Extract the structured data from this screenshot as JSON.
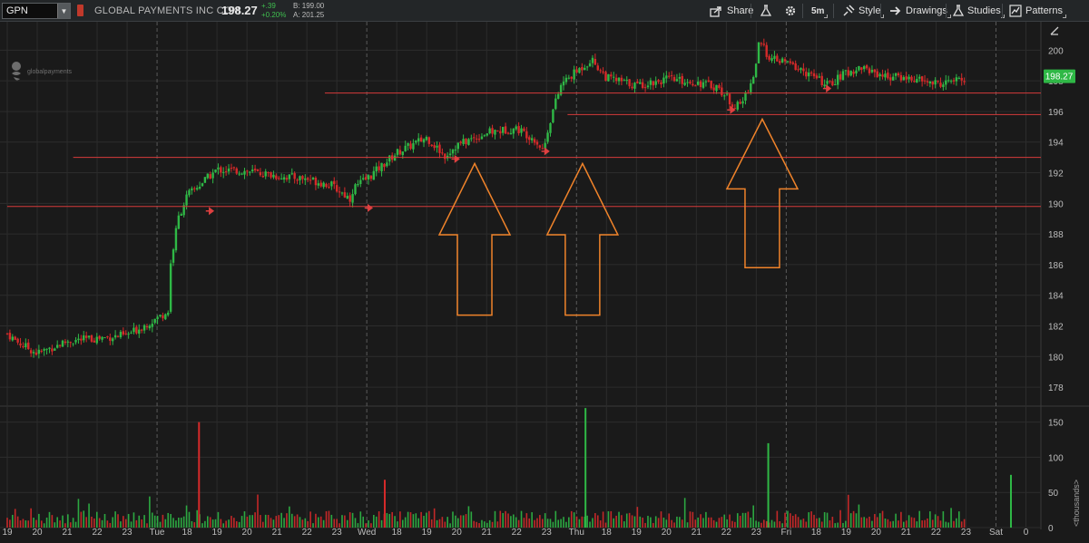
{
  "header": {
    "symbol": "GPN",
    "company_name": "GLOBAL PAYMENTS INC COM",
    "last_price": "198.27",
    "change": "+.39",
    "change_pct": "+0.20%",
    "bid": "B: 199.00",
    "ask": "A: 201.25"
  },
  "toolbar": {
    "share": "Share",
    "timeframe": "5m",
    "style": "Style",
    "drawings": "Drawings",
    "studies": "Studies",
    "patterns": "Patterns"
  },
  "logo": {
    "text": "globalpayments"
  },
  "colors": {
    "up": "#2fb846",
    "down": "#d62a2a",
    "level_line": "#d63a3a",
    "arrow_outline": "#f0832a",
    "price_badge": "#2fb846",
    "grid": "#2c2c2c",
    "session_divider": "#5a5a5a"
  },
  "chart_data": {
    "type": "candlestick",
    "symbol": "GPN",
    "interval": "5m",
    "price_axis": {
      "ticks": [
        178,
        180,
        182,
        184,
        186,
        188,
        190,
        192,
        194,
        196,
        198,
        200
      ],
      "range": [
        177,
        201.5
      ],
      "last_price_label": "198.27"
    },
    "volume_axis": {
      "label": "<thousands>",
      "ticks": [
        0,
        50,
        100,
        150
      ],
      "range": [
        0,
        165
      ]
    },
    "time_axis": {
      "labels": [
        "19",
        "20",
        "21",
        "22",
        "23",
        "Tue",
        "18",
        "19",
        "20",
        "21",
        "22",
        "23",
        "Wed",
        "18",
        "19",
        "20",
        "21",
        "22",
        "23",
        "Thu",
        "18",
        "19",
        "20",
        "21",
        "22",
        "23",
        "Fri",
        "18",
        "19",
        "20",
        "21",
        "22",
        "23",
        "Sat",
        "0"
      ]
    },
    "price_path": [
      [
        0,
        181.5
      ],
      [
        0.3,
        181
      ],
      [
        1,
        180.2
      ],
      [
        2,
        181
      ],
      [
        3,
        181.2
      ],
      [
        4,
        181.4
      ],
      [
        5,
        182.5
      ],
      [
        5.4,
        183
      ],
      [
        5.45,
        186
      ],
      [
        5.7,
        189
      ],
      [
        6,
        190.5
      ],
      [
        7,
        192.2
      ],
      [
        8,
        192.1
      ],
      [
        9,
        191.8
      ],
      [
        10,
        191.6
      ],
      [
        10.8,
        191.2
      ],
      [
        11.45,
        190.3
      ],
      [
        11.55,
        191
      ],
      [
        12,
        191.6
      ],
      [
        13,
        193.3
      ],
      [
        14,
        194.3
      ],
      [
        14.6,
        193.1
      ],
      [
        15,
        193.8
      ],
      [
        16,
        194.6
      ],
      [
        17,
        194.9
      ],
      [
        17.6,
        194.2
      ],
      [
        17.9,
        193.4
      ],
      [
        18,
        194.5
      ],
      [
        18.2,
        196
      ],
      [
        18.5,
        197.8
      ],
      [
        19,
        198.6
      ],
      [
        19.5,
        199.4
      ],
      [
        20,
        198.2
      ],
      [
        21,
        197.7
      ],
      [
        22,
        198.1
      ],
      [
        23,
        197.9
      ],
      [
        23.7,
        197.6
      ],
      [
        24.3,
        196.3
      ],
      [
        24.5,
        196.5
      ],
      [
        24.9,
        198.2
      ],
      [
        25.1,
        200.5
      ],
      [
        25.5,
        199.4
      ],
      [
        26,
        199.2
      ],
      [
        26.6,
        198.6
      ],
      [
        27.4,
        197.7
      ],
      [
        27.9,
        198.4
      ],
      [
        28.5,
        198.9
      ],
      [
        29.3,
        198.3
      ],
      [
        30,
        198.2
      ],
      [
        31,
        197.8
      ],
      [
        32,
        198.1
      ]
    ],
    "horizontal_levels": [
      {
        "price": 197.2,
        "x_start_session": 10.6
      },
      {
        "price": 195.8,
        "x_start_session": 18.7
      },
      {
        "price": 193.0,
        "x_start_session": 2.2
      },
      {
        "price": 189.8,
        "x_start_session": 0
      }
    ],
    "small_arrows": [
      {
        "session": 12.2,
        "price": 189.7
      },
      {
        "session": 6.9,
        "price": 189.5
      },
      {
        "session": 15.1,
        "price": 192.9
      },
      {
        "session": 18.1,
        "price": 193.4
      },
      {
        "session": 24.3,
        "price": 196.1
      },
      {
        "session": 27.5,
        "price": 197.5
      }
    ],
    "annotation_arrows": [
      {
        "tip_session": 15.6,
        "tip_price": 192.6,
        "base_price": 182.7
      },
      {
        "tip_session": 19.2,
        "tip_price": 192.6,
        "base_price": 182.7
      },
      {
        "tip_session": 25.2,
        "tip_price": 195.5,
        "base_price": 185.8
      }
    ],
    "volume_spikes": [
      {
        "session": 6.4,
        "value": 150,
        "up": false
      },
      {
        "session": 19.3,
        "value": 170,
        "up": true
      },
      {
        "session": 25.4,
        "value": 120,
        "up": true
      },
      {
        "session": 12.6,
        "value": 68,
        "up": false
      },
      {
        "session": 33.5,
        "value": 75,
        "up": true
      }
    ]
  }
}
